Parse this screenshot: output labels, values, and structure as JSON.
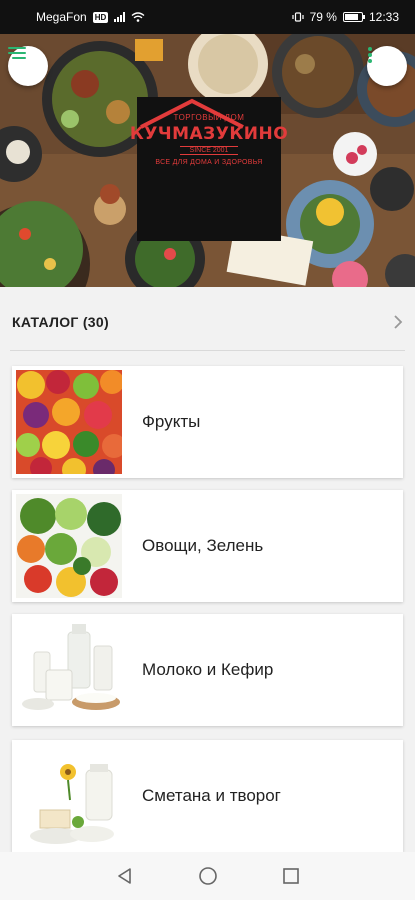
{
  "status_bar": {
    "carrier": "MegaFon",
    "network_badge": "HD",
    "battery_percent": "79 %",
    "battery_level": 0.79,
    "time": "12:33"
  },
  "header": {
    "menu_icon": "hamburger-icon",
    "more_icon": "vertical-dots-icon",
    "accent_color": "#2bb673"
  },
  "logo": {
    "top_text": "ТОРГОВЫЙ ДОМ",
    "brand": "КУЧМАЗУКИНО",
    "since": "SINCE 2001",
    "tagline": "ВСЕ ДЛЯ ДОМА И ЗДОРОВЬЯ",
    "color": "#e23b3b"
  },
  "catalog": {
    "title": "КАТАЛОГ (30)",
    "chevron_icon": "chevron-right-icon",
    "items": [
      {
        "label": "Фрукты"
      },
      {
        "label": "Овощи, Зелень"
      },
      {
        "label": "Молоко и Кефир"
      },
      {
        "label": "Сметана и творог"
      }
    ]
  },
  "nav": {
    "back_icon": "back-triangle-icon",
    "home_icon": "home-circle-icon",
    "recents_icon": "recents-square-icon"
  }
}
